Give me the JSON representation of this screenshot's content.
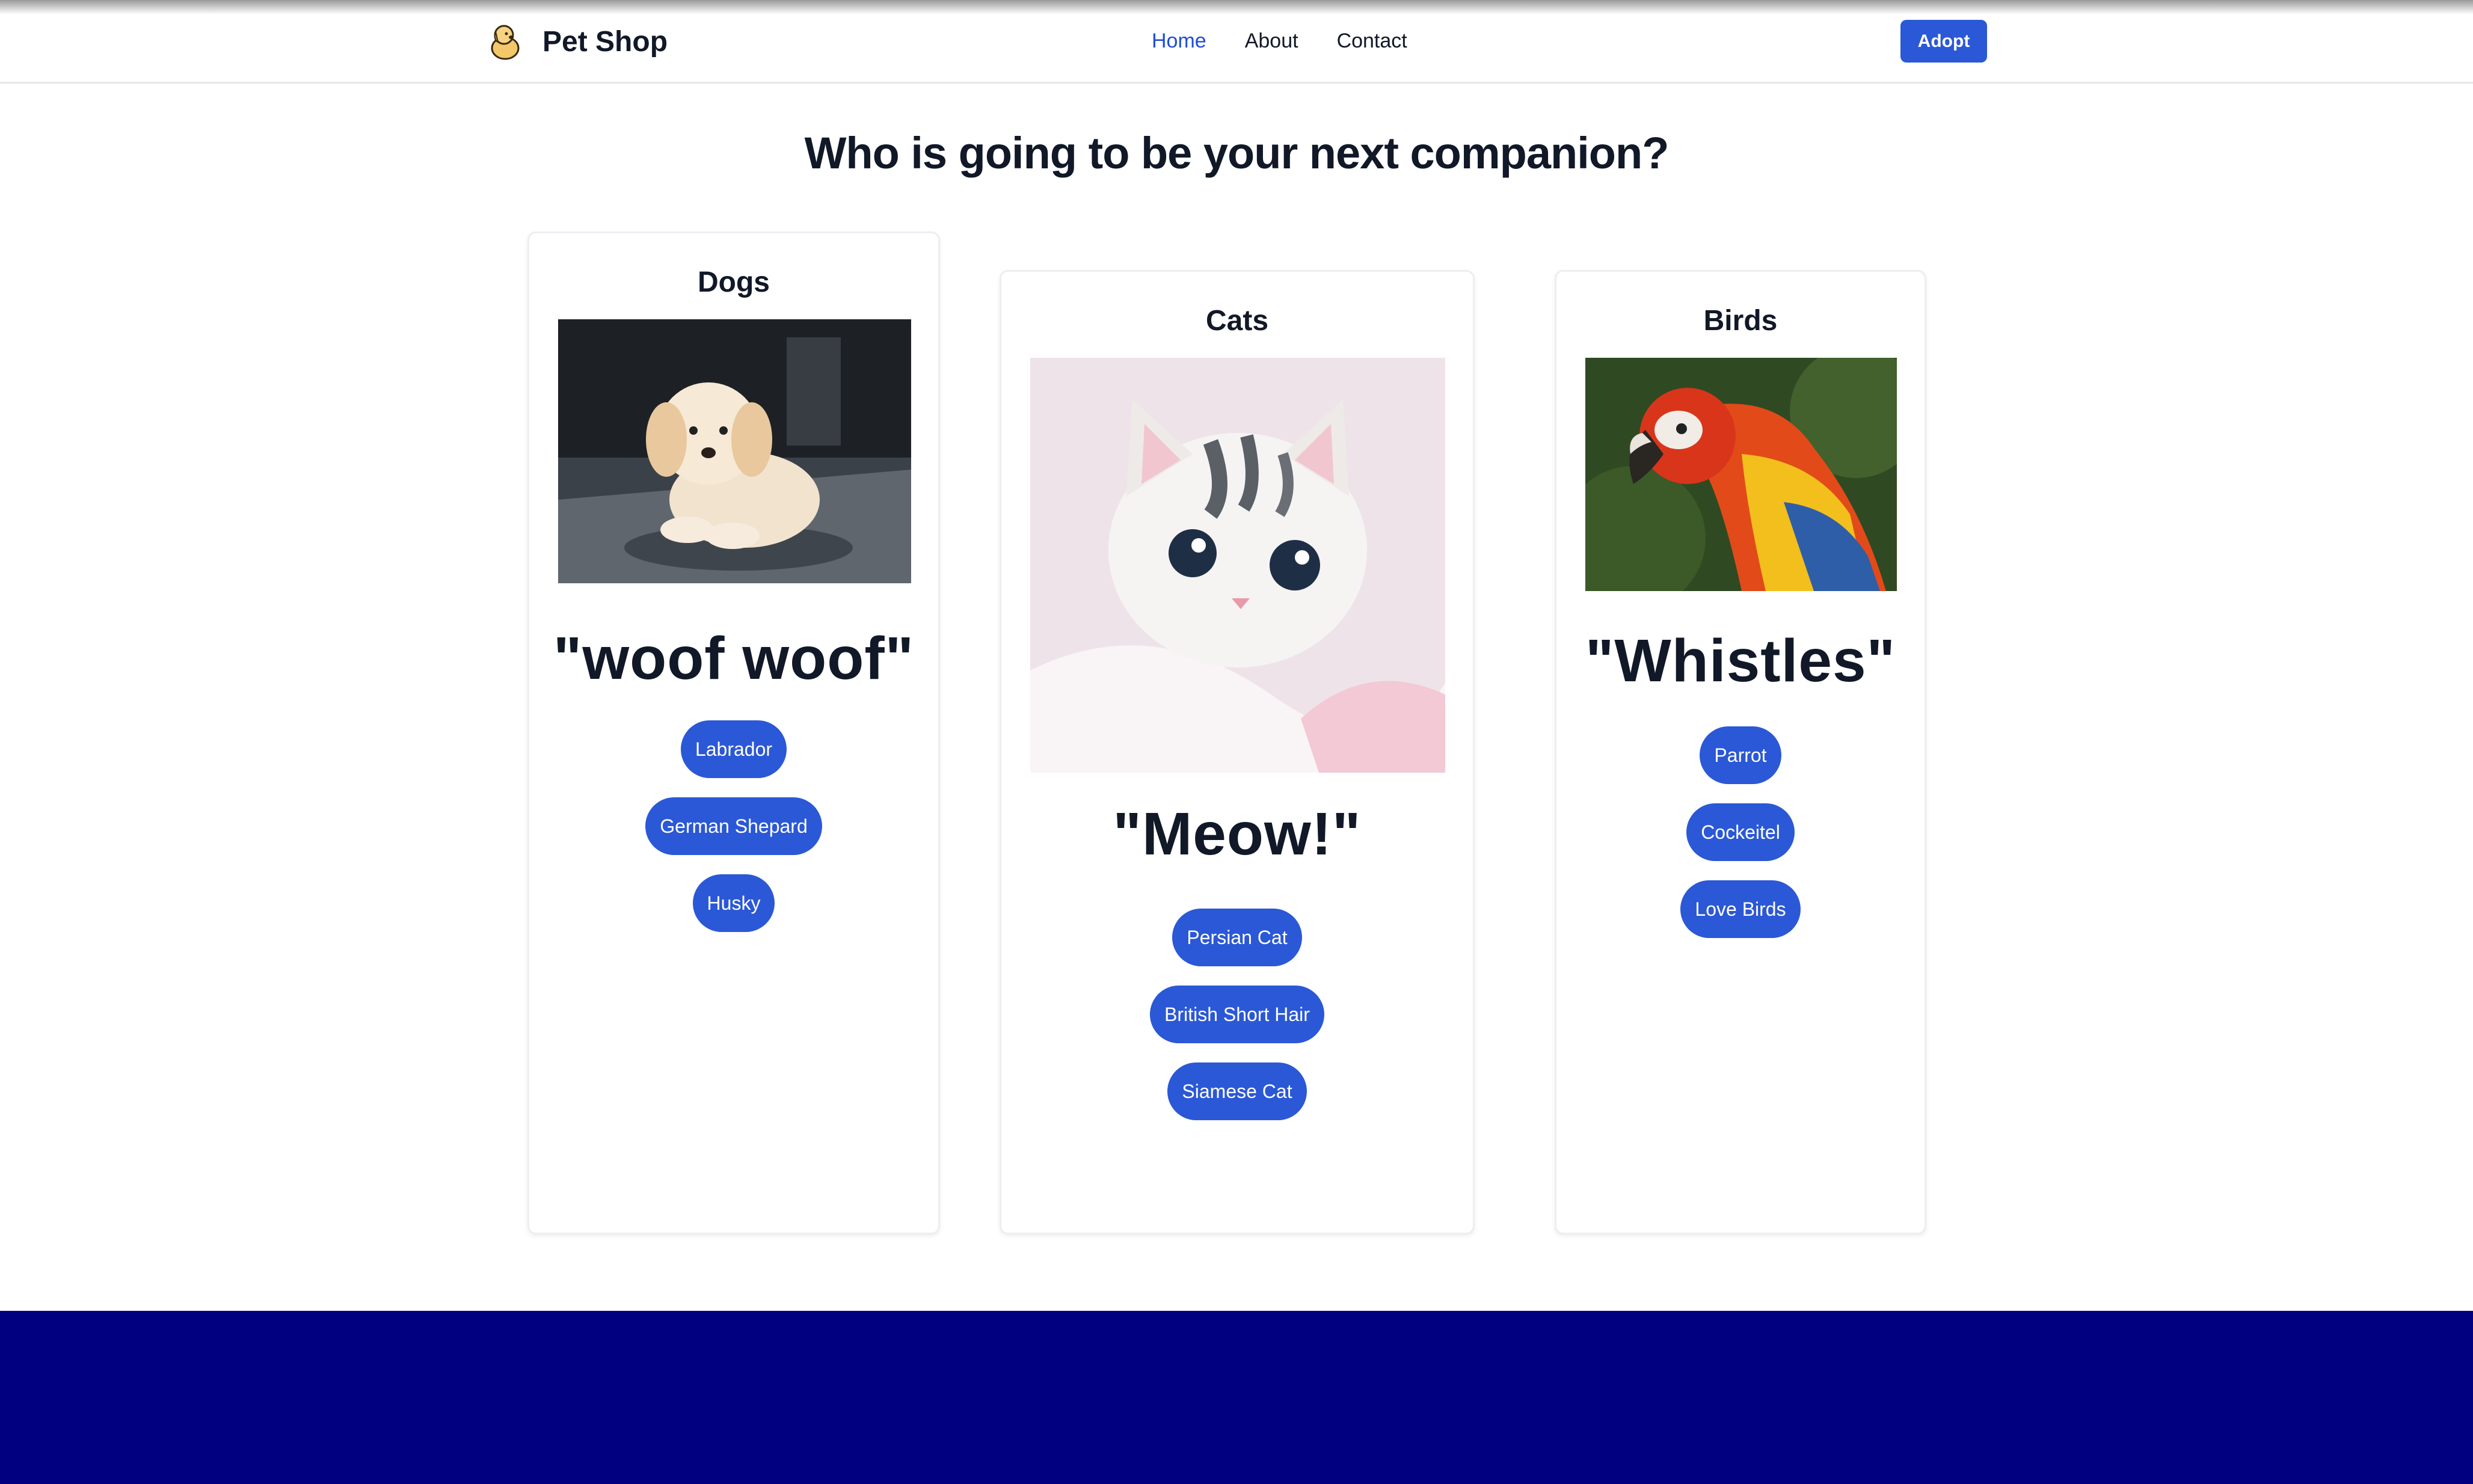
{
  "header": {
    "brand": "Pet Shop",
    "nav": [
      {
        "label": "Home",
        "active": true
      },
      {
        "label": "About",
        "active": false
      },
      {
        "label": "Contact",
        "active": false
      }
    ],
    "adopt_label": "Adopt"
  },
  "main": {
    "headline": "Who is going to be your next companion?",
    "cards": [
      {
        "title": "Dogs",
        "sound": "\"woof woof\"",
        "breeds": [
          "Labrador",
          "German Shepard",
          "Husky"
        ]
      },
      {
        "title": "Cats",
        "sound": "\"Meow!\"",
        "breeds": [
          "Persian Cat",
          "British Short Hair",
          "Siamese Cat"
        ]
      },
      {
        "title": "Birds",
        "sound": "\"Whistles\"",
        "breeds": [
          "Parrot",
          "Cockeitel",
          "Love Birds"
        ]
      }
    ]
  },
  "colors": {
    "accent": "#2b58d6",
    "footer": "#000080",
    "active_link": "#1d4ed8",
    "text": "#111827"
  },
  "icons": {
    "brand": "dog-logo-icon"
  }
}
